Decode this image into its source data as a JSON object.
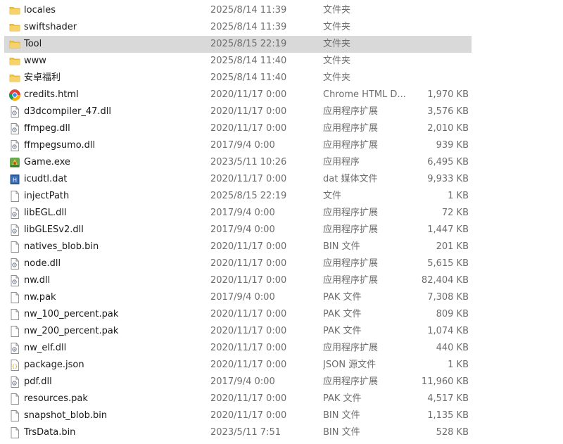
{
  "files": [
    {
      "name": "locales",
      "date": "2025/8/14 11:39",
      "type": "文件夹",
      "size": "",
      "icon": "folder-icon",
      "selected": false
    },
    {
      "name": "swiftshader",
      "date": "2025/8/14 11:39",
      "type": "文件夹",
      "size": "",
      "icon": "folder-icon",
      "selected": false
    },
    {
      "name": "Tool",
      "date": "2025/8/15 22:19",
      "type": "文件夹",
      "size": "",
      "icon": "folder-icon",
      "selected": true
    },
    {
      "name": "www",
      "date": "2025/8/14 11:40",
      "type": "文件夹",
      "size": "",
      "icon": "folder-icon",
      "selected": false
    },
    {
      "name": "安卓福利",
      "date": "2025/8/14 11:40",
      "type": "文件夹",
      "size": "",
      "icon": "folder-icon",
      "selected": false
    },
    {
      "name": "credits.html",
      "date": "2020/11/17 0:00",
      "type": "Chrome HTML D...",
      "size": "1,970 KB",
      "icon": "chrome-html-icon",
      "selected": false
    },
    {
      "name": "d3dcompiler_47.dll",
      "date": "2020/11/17 0:00",
      "type": "应用程序扩展",
      "size": "3,576 KB",
      "icon": "dll-icon",
      "selected": false
    },
    {
      "name": "ffmpeg.dll",
      "date": "2020/11/17 0:00",
      "type": "应用程序扩展",
      "size": "2,010 KB",
      "icon": "dll-icon",
      "selected": false
    },
    {
      "name": "ffmpegsumo.dll",
      "date": "2017/9/4 0:00",
      "type": "应用程序扩展",
      "size": "939 KB",
      "icon": "dll-icon",
      "selected": false
    },
    {
      "name": "Game.exe",
      "date": "2023/5/11 10:26",
      "type": "应用程序",
      "size": "6,495 KB",
      "icon": "exe-icon",
      "selected": false
    },
    {
      "name": "icudtl.dat",
      "date": "2020/11/17 0:00",
      "type": "dat 媒体文件",
      "size": "9,933 KB",
      "icon": "dat-icon",
      "selected": false
    },
    {
      "name": "injectPath",
      "date": "2025/8/15 22:19",
      "type": "文件",
      "size": "1 KB",
      "icon": "file-icon",
      "selected": false
    },
    {
      "name": "libEGL.dll",
      "date": "2017/9/4 0:00",
      "type": "应用程序扩展",
      "size": "72 KB",
      "icon": "dll-icon",
      "selected": false
    },
    {
      "name": "libGLESv2.dll",
      "date": "2017/9/4 0:00",
      "type": "应用程序扩展",
      "size": "1,447 KB",
      "icon": "dll-icon",
      "selected": false
    },
    {
      "name": "natives_blob.bin",
      "date": "2020/11/17 0:00",
      "type": "BIN 文件",
      "size": "201 KB",
      "icon": "file-icon",
      "selected": false
    },
    {
      "name": "node.dll",
      "date": "2020/11/17 0:00",
      "type": "应用程序扩展",
      "size": "5,615 KB",
      "icon": "dll-icon",
      "selected": false
    },
    {
      "name": "nw.dll",
      "date": "2020/11/17 0:00",
      "type": "应用程序扩展",
      "size": "82,404 KB",
      "icon": "dll-icon",
      "selected": false
    },
    {
      "name": "nw.pak",
      "date": "2017/9/4 0:00",
      "type": "PAK 文件",
      "size": "7,308 KB",
      "icon": "file-icon",
      "selected": false
    },
    {
      "name": "nw_100_percent.pak",
      "date": "2020/11/17 0:00",
      "type": "PAK 文件",
      "size": "809 KB",
      "icon": "file-icon",
      "selected": false
    },
    {
      "name": "nw_200_percent.pak",
      "date": "2020/11/17 0:00",
      "type": "PAK 文件",
      "size": "1,074 KB",
      "icon": "file-icon",
      "selected": false
    },
    {
      "name": "nw_elf.dll",
      "date": "2020/11/17 0:00",
      "type": "应用程序扩展",
      "size": "440 KB",
      "icon": "dll-icon",
      "selected": false
    },
    {
      "name": "package.json",
      "date": "2020/11/17 0:00",
      "type": "JSON 源文件",
      "size": "1 KB",
      "icon": "json-icon",
      "selected": false
    },
    {
      "name": "pdf.dll",
      "date": "2017/9/4 0:00",
      "type": "应用程序扩展",
      "size": "11,960 KB",
      "icon": "dll-icon",
      "selected": false
    },
    {
      "name": "resources.pak",
      "date": "2020/11/17 0:00",
      "type": "PAK 文件",
      "size": "4,517 KB",
      "icon": "file-icon",
      "selected": false
    },
    {
      "name": "snapshot_blob.bin",
      "date": "2020/11/17 0:00",
      "type": "BIN 文件",
      "size": "1,135 KB",
      "icon": "file-icon",
      "selected": false
    },
    {
      "name": "TrsData.bin",
      "date": "2023/5/11 7:51",
      "type": "BIN 文件",
      "size": "528 KB",
      "icon": "file-icon",
      "selected": false
    }
  ],
  "colors": {
    "selected_row": "#d9d9d9",
    "folder": "#f0c44c",
    "text_primary": "#1a1a1a",
    "text_secondary": "#6d6d6d"
  }
}
